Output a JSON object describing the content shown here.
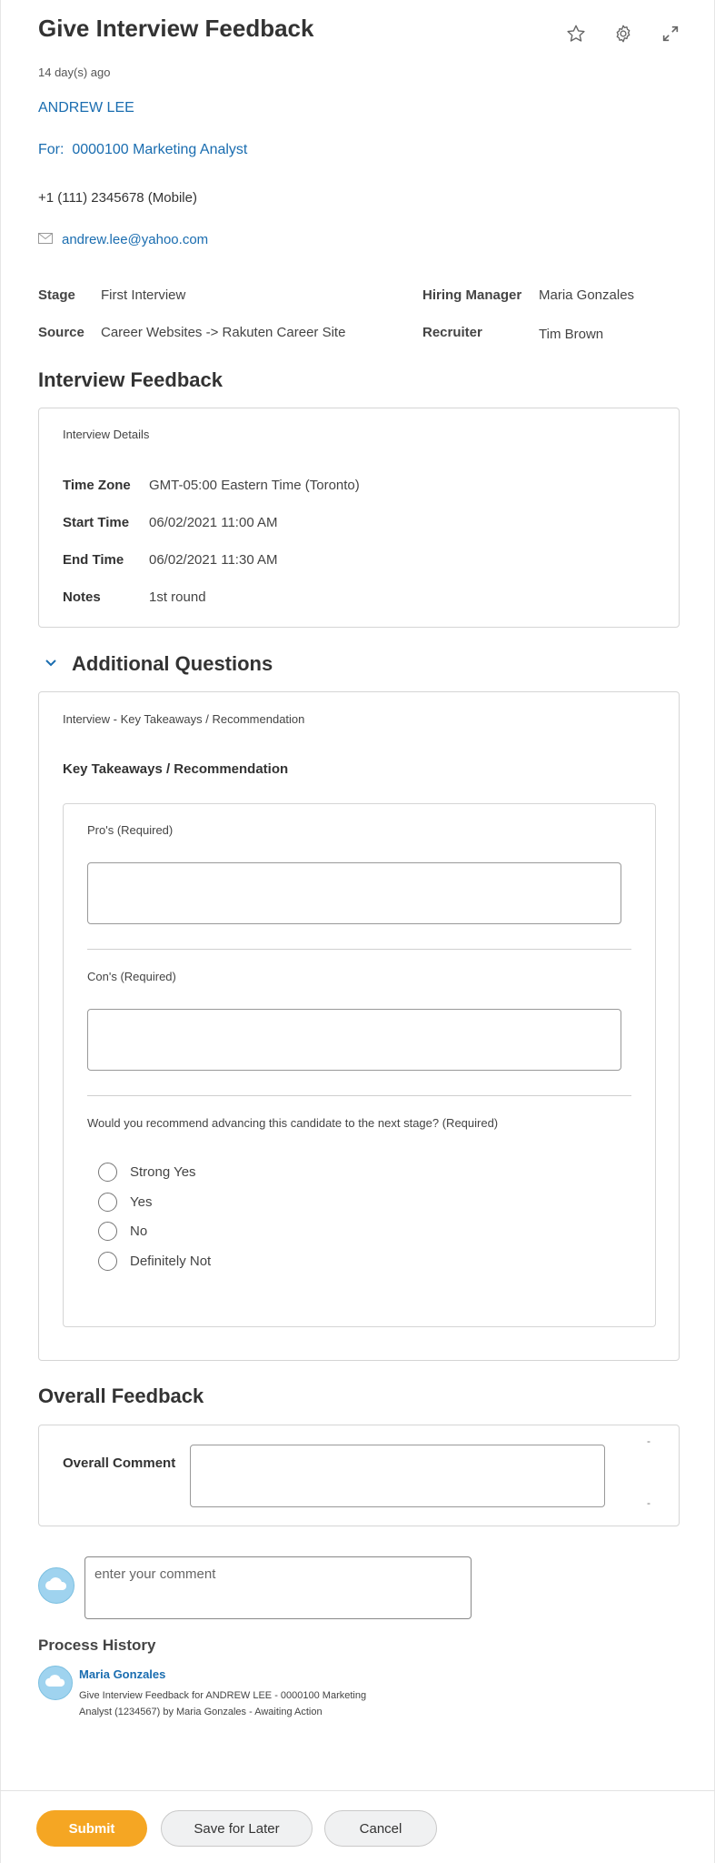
{
  "header": {
    "title": "Give Interview Feedback",
    "age": "14 day(s) ago",
    "icons": [
      "star-icon",
      "gear-icon",
      "expand-icon"
    ]
  },
  "candidate": {
    "name": "ANDREW LEE",
    "for_prefix": "For:",
    "for_job": "0000100 Marketing Analyst",
    "phone": "+1 (111) 2345678 (Mobile)",
    "email": "andrew.lee@yahoo.com"
  },
  "info": {
    "stage_label": "Stage",
    "stage_value": "First Interview",
    "source_label": "Source",
    "source_value": "Career Websites -> Rakuten Career Site",
    "manager_label": "Hiring Manager",
    "manager_value": "Maria Gonzales",
    "recruiter_label": "Recruiter",
    "recruiter_value": "Tim Brown"
  },
  "interview_feedback": {
    "title": "Interview Feedback",
    "details_label": "Interview Details",
    "rows": [
      {
        "label": "Time Zone",
        "value": "GMT-05:00 Eastern Time (Toronto)"
      },
      {
        "label": "Start Time",
        "value": "06/02/2021 11:00 AM"
      },
      {
        "label": "End Time",
        "value": "06/02/2021 11:30 AM"
      },
      {
        "label": "Notes",
        "value": "1st round"
      }
    ]
  },
  "additional_questions": {
    "title": "Additional Questions",
    "card_label": "Interview - Key Takeaways / Recommendation",
    "subtitle": "Key Takeaways / Recommendation",
    "pros_label": "Pro's (Required)",
    "cons_label": "Con's (Required)",
    "recommend_label": "Would you recommend advancing this candidate to the next stage? (Required)",
    "options": [
      "Strong Yes",
      "Yes",
      "No",
      "Definitely Not"
    ]
  },
  "overall_feedback": {
    "title": "Overall Feedback",
    "comment_label": "Overall Comment",
    "side_marks": [
      "-",
      "-"
    ]
  },
  "comment": {
    "placeholder": "enter your comment"
  },
  "process_history": {
    "title": "Process History",
    "author": "Maria Gonzales",
    "line1": "Give Interview Feedback for ANDREW LEE - 0000100 Marketing",
    "line2": "Analyst (1234567) by Maria Gonzales - Awaiting Action"
  },
  "footer": {
    "submit": "Submit",
    "save_later": "Save for Later",
    "cancel": "Cancel"
  },
  "colors": {
    "accent": "#1a6db0",
    "primary_button": "#f5a623",
    "avatar": "#9fd3ef"
  }
}
